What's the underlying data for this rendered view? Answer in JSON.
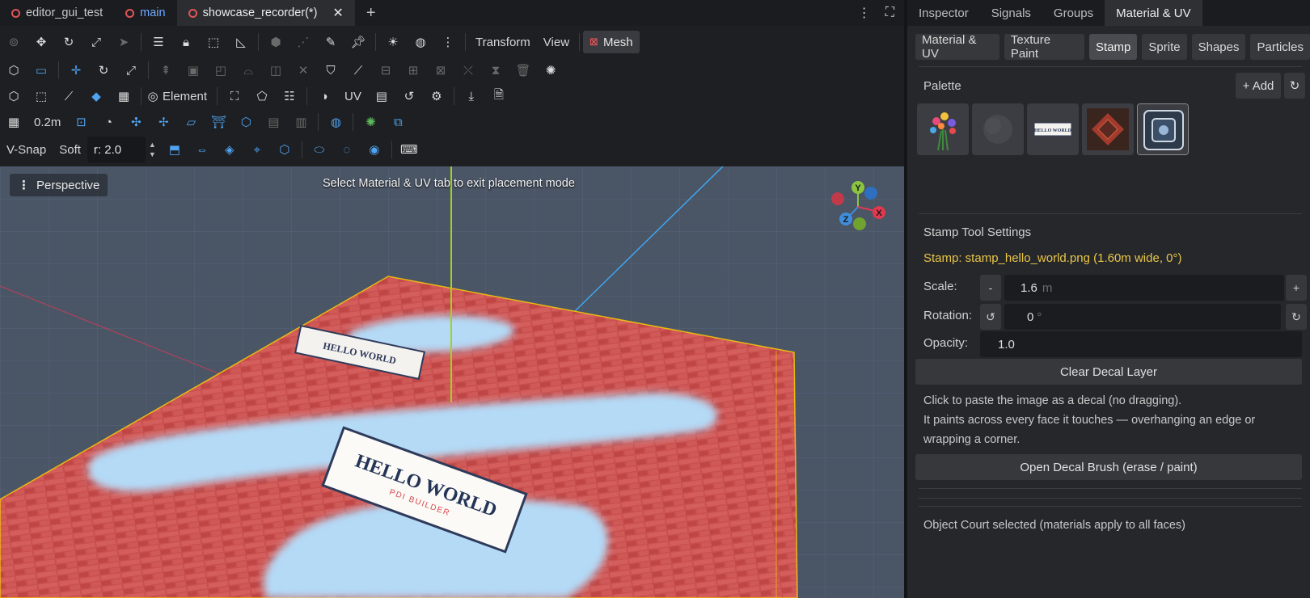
{
  "scene_tabs": [
    {
      "label": "editor_gui_test"
    },
    {
      "label": "main"
    },
    {
      "label": "showcase_recorder(*)"
    }
  ],
  "toolbar": {
    "transform_label": "Transform",
    "view_label": "View",
    "mesh_label": "Mesh",
    "element_label": "Element",
    "uv_label": "UV",
    "grid_size": "0.2m",
    "vsnap_label": "V-Snap",
    "soft_label": "Soft",
    "radius_value": "r: 2.0"
  },
  "viewport": {
    "mode_label": "Perspective",
    "hint": "Select Material & UV tab to exit placement mode",
    "stamp_text": "HELLO WORLD",
    "stamp_subtext": "PDI BUILDER",
    "gizmo": {
      "x": "X",
      "y": "Y",
      "z": "Z",
      "x_color": "#e2384f",
      "y_color": "#8bc53f",
      "z_color": "#3f8ddb"
    }
  },
  "dock_tabs": [
    "Inspector",
    "Signals",
    "Groups",
    "Material & UV"
  ],
  "sub_tabs": [
    "Material & UV",
    "Texture Paint",
    "Stamp",
    "Sprite",
    "Shapes",
    "Particles"
  ],
  "palette": {
    "title": "Palette",
    "add_label": "+ Add",
    "stamp_thumb_text": "HELLO WORLD"
  },
  "stamp_settings": {
    "title": "Stamp Tool Settings",
    "status": "Stamp: stamp_hello_world.png (1.60m wide, 0°)",
    "scale_label": "Scale:",
    "scale_value": "1.6",
    "scale_unit": "m",
    "rotation_label": "Rotation:",
    "rotation_value": "0",
    "rotation_unit": "°",
    "opacity_label": "Opacity:",
    "opacity_value": "1.0",
    "clear_label": "Clear Decal Layer",
    "help_line1": "Click to paste the image as a decal (no dragging).",
    "help_line2": "It paints across every face it touches — overhanging an edge or",
    "help_line3": "wrapping a corner.",
    "brush_label": "Open Decal Brush (erase / paint)",
    "selection_note": "Object Court selected (materials apply to all faces)"
  },
  "colors": {
    "status_yellow": "#e8c547",
    "brick_red": "#c9504f",
    "tile_blue": "#a9d4f5",
    "selection_yellow": "#ffd200"
  }
}
